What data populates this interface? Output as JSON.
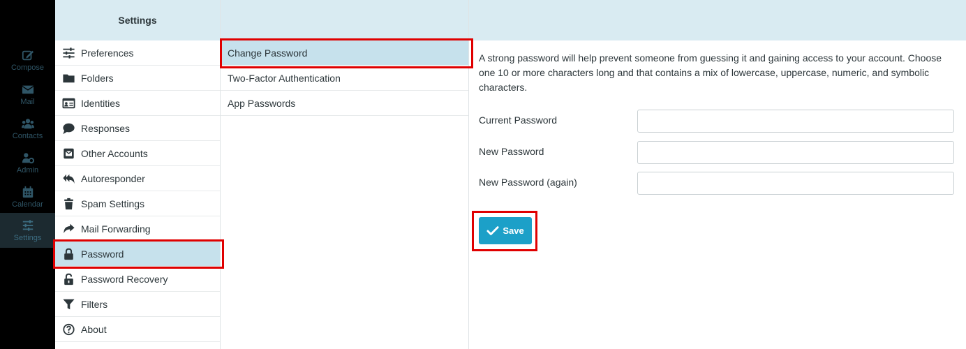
{
  "nav": {
    "items": [
      {
        "label": "Compose",
        "icon": "compose-icon"
      },
      {
        "label": "Mail",
        "icon": "mail-icon"
      },
      {
        "label": "Contacts",
        "icon": "contacts-icon"
      },
      {
        "label": "Admin",
        "icon": "admin-icon"
      },
      {
        "label": "Calendar",
        "icon": "calendar-icon"
      },
      {
        "label": "Settings",
        "icon": "sliders-icon",
        "active": true
      }
    ]
  },
  "settings": {
    "title": "Settings",
    "items": [
      {
        "label": "Preferences",
        "icon": "sliders-icon"
      },
      {
        "label": "Folders",
        "icon": "folder-icon"
      },
      {
        "label": "Identities",
        "icon": "id-card-icon"
      },
      {
        "label": "Responses",
        "icon": "speech-bubble-icon"
      },
      {
        "label": "Other Accounts",
        "icon": "envelope-square-icon"
      },
      {
        "label": "Autoresponder",
        "icon": "reply-all-icon"
      },
      {
        "label": "Spam Settings",
        "icon": "trash-icon"
      },
      {
        "label": "Mail Forwarding",
        "icon": "share-arrow-icon"
      },
      {
        "label": "Password",
        "icon": "lock-icon",
        "active": true
      },
      {
        "label": "Password Recovery",
        "icon": "unlock-icon"
      },
      {
        "label": "Filters",
        "icon": "filter-icon"
      },
      {
        "label": "About",
        "icon": "question-circle-icon"
      }
    ]
  },
  "sections": {
    "items": [
      {
        "label": "Change Password",
        "active": true
      },
      {
        "label": "Two-Factor Authentication"
      },
      {
        "label": "App Passwords"
      }
    ]
  },
  "content": {
    "description": "A strong password will help prevent someone from guessing it and gaining access to your account. Choose one 10 or more characters long and that contains a mix of lowercase, uppercase, numeric, and symbolic characters.",
    "fields": [
      {
        "label": "Current Password",
        "value": ""
      },
      {
        "label": "New Password",
        "value": ""
      },
      {
        "label": "New Password (again)",
        "value": ""
      }
    ],
    "save_label": "Save"
  },
  "colors": {
    "header_bg": "#d9ebf2",
    "active_bg": "#c6e1ec",
    "button_bg": "#1ca0c8",
    "highlight": "#e00000"
  }
}
